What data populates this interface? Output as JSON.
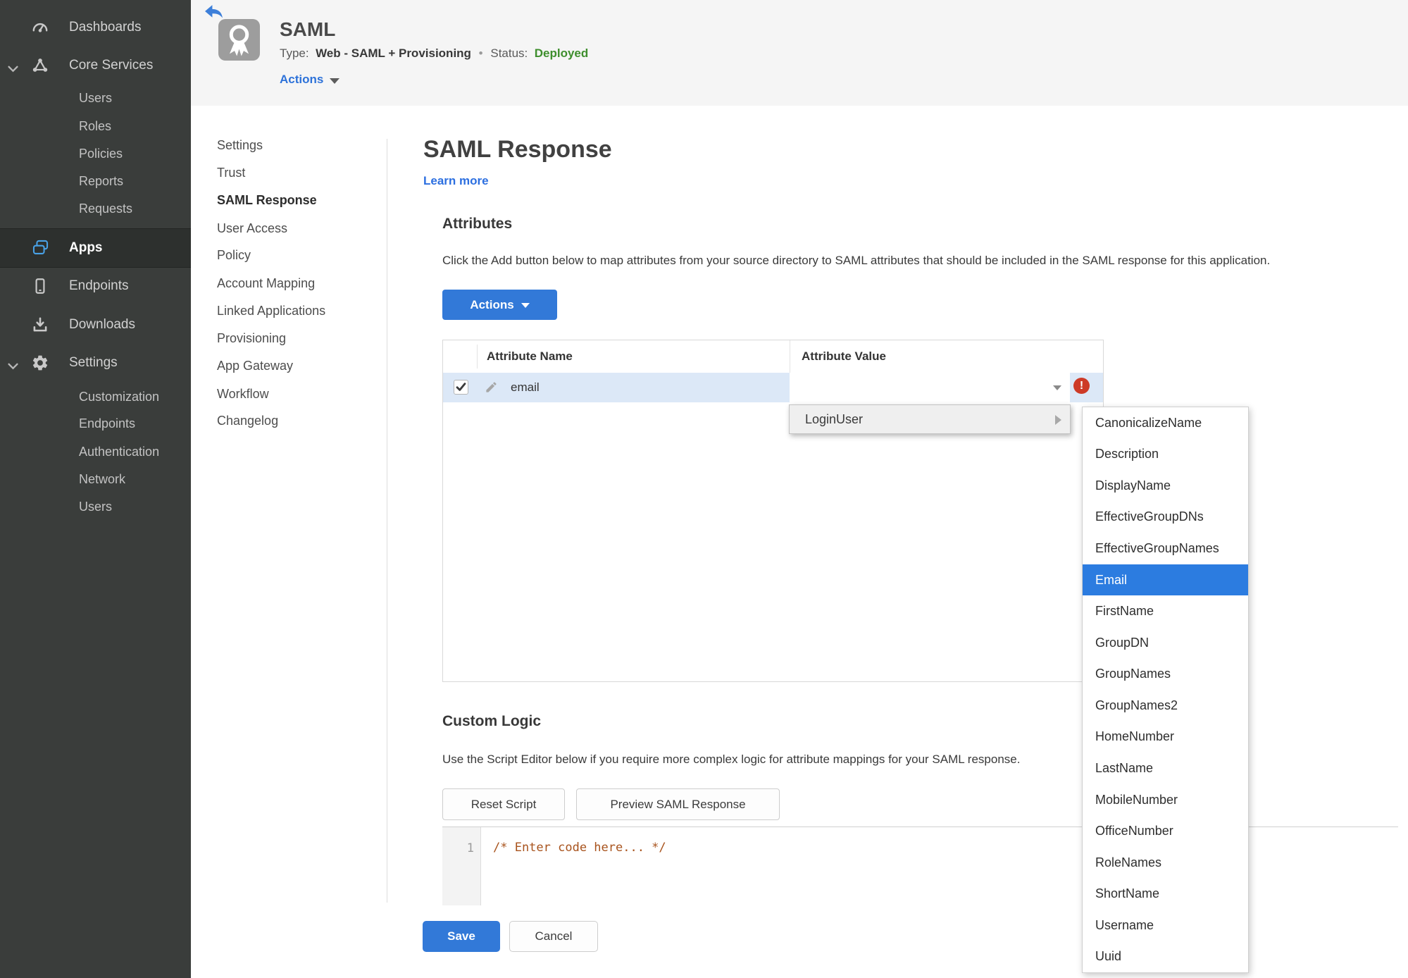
{
  "colors": {
    "accent_blue": "#3279d8",
    "link_blue": "#2c6fe0",
    "status_green": "#3e8e2d",
    "error_red": "#cd3a27",
    "selected_row_blue": "#dce8f7",
    "sidebar_bg": "#3a3d3b"
  },
  "sidebar": {
    "items": [
      {
        "label": "Dashboards"
      },
      {
        "label": "Core Services",
        "expanded": true,
        "children": [
          "Users",
          "Roles",
          "Policies",
          "Reports",
          "Requests"
        ]
      },
      {
        "label": "Apps",
        "active": true
      },
      {
        "label": "Endpoints"
      },
      {
        "label": "Downloads"
      },
      {
        "label": "Settings",
        "expanded": true,
        "children": [
          "Customization",
          "Endpoints",
          "Authentication",
          "Network",
          "Users"
        ]
      }
    ]
  },
  "header": {
    "title": "SAML",
    "type_label": "Type:",
    "type_value": "Web - SAML + Provisioning",
    "dot": "•",
    "status_label": "Status:",
    "status_value": "Deployed",
    "actions_label": "Actions"
  },
  "subnav": {
    "items": [
      "Settings",
      "Trust",
      "SAML Response",
      "User Access",
      "Policy",
      "Account Mapping",
      "Linked Applications",
      "Provisioning",
      "App Gateway",
      "Workflow",
      "Changelog"
    ],
    "active": "SAML Response"
  },
  "content": {
    "title": "SAML Response",
    "learn_more": "Learn more",
    "attributes": {
      "heading": "Attributes",
      "description": "Click the Add button below to map attributes from your source directory to SAML attributes that should be included in the SAML response for this application.",
      "actions_button": "Actions",
      "table": {
        "columns": [
          "Attribute Name",
          "Attribute Value"
        ],
        "rows": [
          {
            "name": "email",
            "value": "",
            "checked": true,
            "error": "!"
          }
        ]
      }
    },
    "value_menu": {
      "label": "LoginUser",
      "selected": "Email",
      "items": [
        "CanonicalizeName",
        "Description",
        "DisplayName",
        "EffectiveGroupDNs",
        "EffectiveGroupNames",
        "Email",
        "FirstName",
        "GroupDN",
        "GroupNames",
        "GroupNames2",
        "HomeNumber",
        "LastName",
        "MobileNumber",
        "OfficeNumber",
        "RoleNames",
        "ShortName",
        "Username",
        "Uuid"
      ]
    },
    "custom_logic": {
      "heading": "Custom Logic",
      "description": "Use the Script Editor below if you require more complex logic for attribute mappings for your SAML response.",
      "reset_button": "Reset Script",
      "preview_button": "Preview SAML Response",
      "editor": {
        "line_number": "1",
        "code": "/* Enter code here... */"
      }
    },
    "footer": {
      "save": "Save",
      "cancel": "Cancel"
    }
  }
}
